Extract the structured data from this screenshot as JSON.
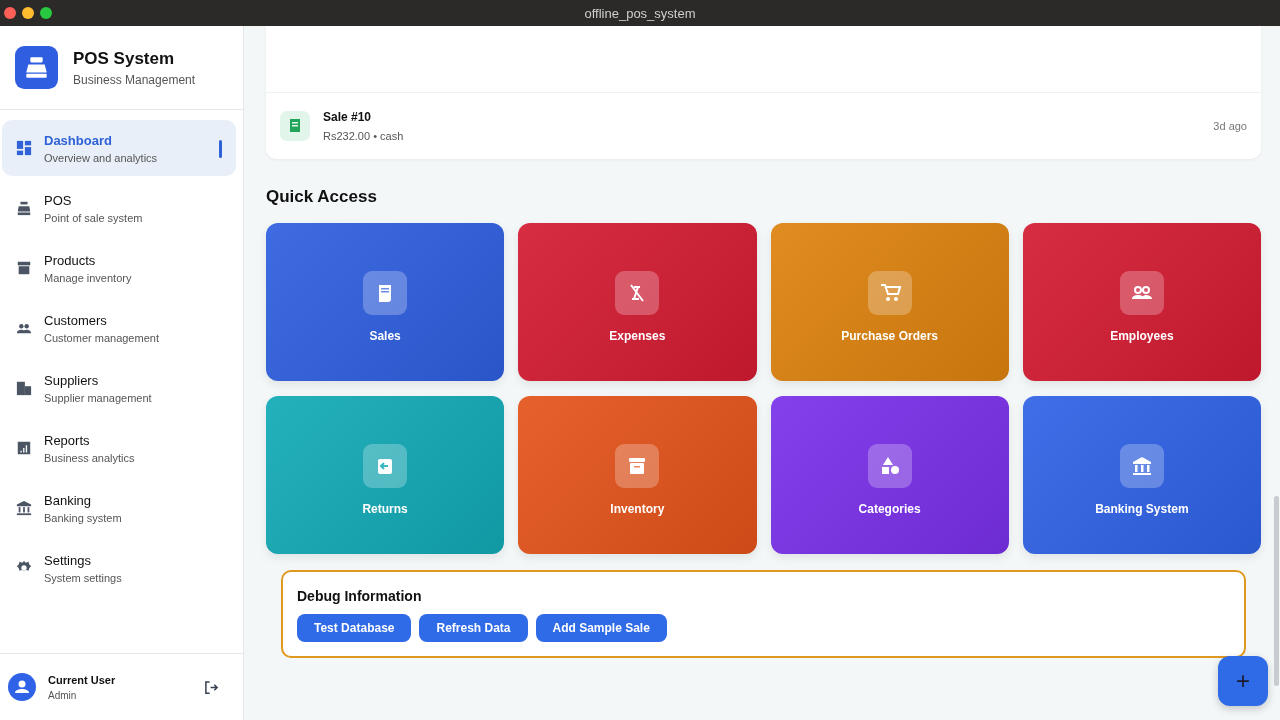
{
  "window": {
    "title": "offline_pos_system"
  },
  "sidebar": {
    "app_name": "POS System",
    "app_subtitle": "Business Management",
    "items": [
      {
        "label": "Dashboard",
        "description": "Overview and analytics",
        "selected": true
      },
      {
        "label": "POS",
        "description": "Point of sale system",
        "selected": false
      },
      {
        "label": "Products",
        "description": "Manage inventory",
        "selected": false
      },
      {
        "label": "Customers",
        "description": "Customer management",
        "selected": false
      },
      {
        "label": "Suppliers",
        "description": "Supplier management",
        "selected": false
      },
      {
        "label": "Reports",
        "description": "Business analytics",
        "selected": false
      },
      {
        "label": "Banking",
        "description": "Banking system",
        "selected": false
      },
      {
        "label": "Settings",
        "description": "System settings",
        "selected": false
      }
    ],
    "user": {
      "name": "Current User",
      "role": "Admin"
    }
  },
  "recent_sales": [
    {
      "title": "Sale #10",
      "detail": "Rs232.00 • cash",
      "time": "3d ago"
    }
  ],
  "quick_access": {
    "title": "Quick Access",
    "tiles": [
      {
        "label": "Sales",
        "color": "#2f5fe0"
      },
      {
        "label": "Expenses",
        "color": "#d41b32"
      },
      {
        "label": "Purchase Orders",
        "color": "#dd820e"
      },
      {
        "label": "Employees",
        "color": "#d41b32"
      },
      {
        "label": "Returns",
        "color": "#12aab6"
      },
      {
        "label": "Inventory",
        "color": "#e4531a"
      },
      {
        "label": "Categories",
        "color": "#7a30ea"
      },
      {
        "label": "Banking System",
        "color": "#2f62e6"
      }
    ]
  },
  "debug": {
    "title": "Debug Information",
    "buttons": [
      "Test Database",
      "Refresh Data",
      "Add Sample Sale"
    ]
  },
  "fab": {
    "label": "+"
  }
}
